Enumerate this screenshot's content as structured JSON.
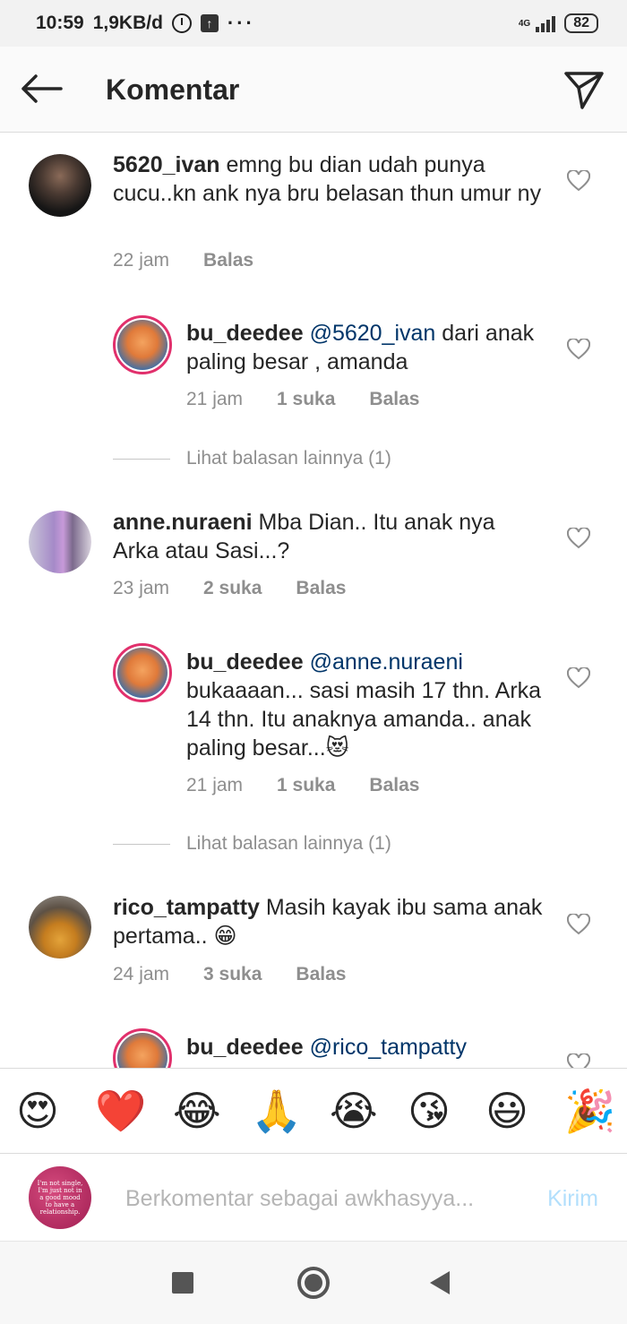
{
  "status_bar": {
    "time": "10:59",
    "data_rate": "1,9KB/d",
    "network": "4G",
    "battery": "82"
  },
  "header": {
    "title": "Komentar"
  },
  "comments": [
    {
      "username": "5620_ivan",
      "mention": "",
      "text": "emng bu dian udah punya cucu..kn ank nya bru belasan thun umur ny",
      "time": "22 jam",
      "likes": "",
      "reply_label": "Balas"
    },
    {
      "username": "bu_deedee",
      "mention": "@5620_ivan",
      "text": "dari anak paling besar , amanda",
      "time": "21 jam",
      "likes": "1 suka",
      "reply_label": "Balas"
    },
    {
      "username": "anne.nuraeni",
      "mention": "",
      "text": "Mba Dian.. Itu anak nya Arka atau Sasi...?",
      "time": "23 jam",
      "likes": "2 suka",
      "reply_label": "Balas"
    },
    {
      "username": "bu_deedee",
      "mention": "@anne.nuraeni",
      "text": "bukaaaan... sasi masih 17 thn. Arka 14 thn.  Itu anaknya amanda.. anak paling besar...😻",
      "time": "21 jam",
      "likes": "1 suka",
      "reply_label": "Balas"
    },
    {
      "username": "rico_tampatty",
      "mention": "",
      "text": "Masih kayak ibu sama anak pertama.. 😁",
      "time": "24 jam",
      "likes": "3 suka",
      "reply_label": "Balas"
    },
    {
      "username": "bu_deedee",
      "mention": "@rico_tampatty",
      "text": "",
      "time": "",
      "likes": "",
      "reply_label": ""
    }
  ],
  "view_replies": [
    "Lihat balasan lainnya (1)",
    "Lihat balasan lainnya (1)"
  ],
  "emoji_bar": [
    "😍",
    "❤️",
    "😂",
    "🙏",
    "😭",
    "😘",
    "😃",
    "🎉"
  ],
  "composer": {
    "avatar_text": "I'm not single, I'm just not in a good mood to have a relationship.",
    "placeholder": "Berkomentar sebagai awkhasyya...",
    "post_label": "Kirim"
  },
  "colors": {
    "link": "#003569",
    "meta": "#8e8e8e",
    "post_disabled": "#b2dffc",
    "story_ring": "#e1306c"
  }
}
